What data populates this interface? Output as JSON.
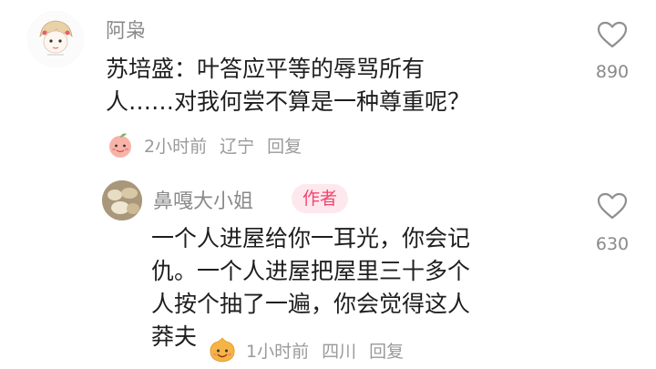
{
  "comment": {
    "username": "阿枭",
    "text_lines": [
      "苏培盛：叶答应平等的辱骂所有",
      "人……对我何尝不算是一种尊重呢？"
    ],
    "time": "2小时前",
    "location": "辽宁",
    "reply_label": "回复",
    "likes": "890"
  },
  "reply": {
    "username": "鼻嘎大小姐",
    "badge": "作者",
    "text_lines": [
      "一个人进屋给你一耳光，你会记",
      "仇。一个人进屋把屋里三十多个",
      "人按个抽了一遍，你会觉得这人",
      "莽夫"
    ],
    "time": "1小时前",
    "location": "四川",
    "reply_label": "回复",
    "likes": "630"
  },
  "colors": {
    "accent": "#f2446c",
    "badge_bg": "#fde8ee",
    "meta": "#9a9a9a"
  },
  "icons": {
    "like": "heart-outline-icon",
    "emoji_main": "peach-emoji-icon",
    "emoji_reply": "smiling-blob-emoji-icon"
  }
}
